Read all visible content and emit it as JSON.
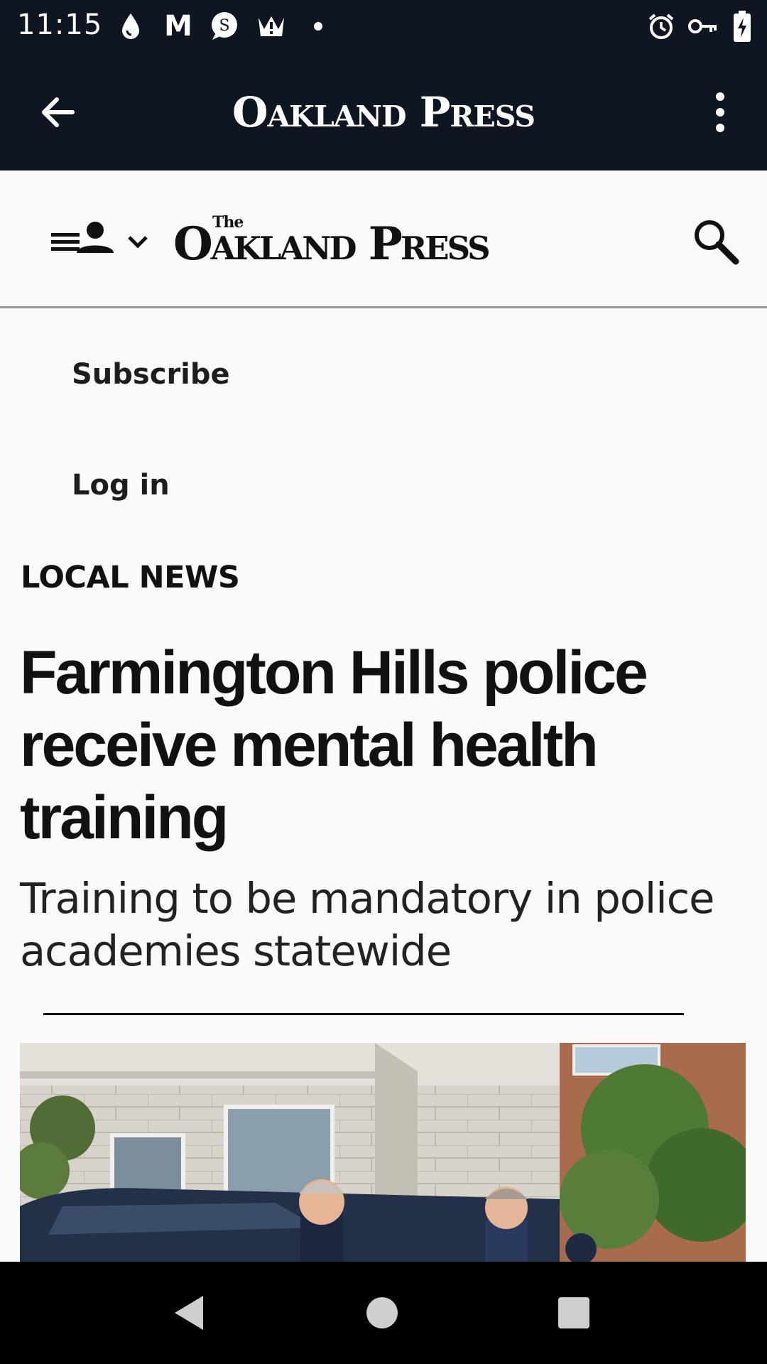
{
  "status_bar": {
    "time": "11:15",
    "left_icons": [
      "water-drop-icon",
      "gmail-icon",
      "s-chat-icon",
      "crown-alert-icon",
      "dot-icon"
    ],
    "right_icons": [
      "alarm-icon",
      "vpn-key-icon",
      "battery-charging-icon"
    ],
    "mail_letter": "M",
    "chat_letter": "S"
  },
  "app_bar": {
    "title": "Oakland Press"
  },
  "site_header": {
    "logo_the": "The",
    "logo_name": "Oakland Press"
  },
  "account": {
    "subscribe": "Subscribe",
    "login": "Log in"
  },
  "article": {
    "section": "LOCAL NEWS",
    "headline": "Farmington Hills police receive mental health training",
    "subheadline": "Training to be mandatory in police academies statewide"
  },
  "colors": {
    "header_dark": "#0d1621",
    "page_bg": "#fafafa",
    "text": "#111111"
  }
}
